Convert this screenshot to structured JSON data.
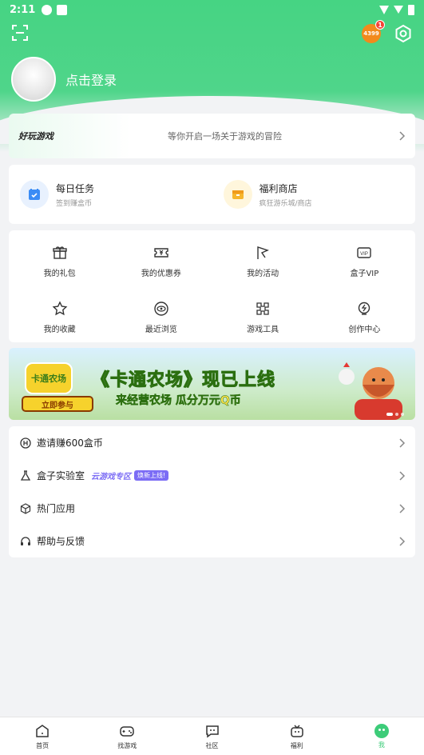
{
  "status_bar": {
    "time": "2:11"
  },
  "header": {
    "login_text": "点击登录",
    "box_logo_text": "4399",
    "notification_count": "1"
  },
  "adventure": {
    "logo_text": "好玩游戏",
    "text": "等你开启一场关于游戏的冒险"
  },
  "tasks": [
    {
      "title": "每日任务",
      "subtitle": "签到赚盒币"
    },
    {
      "title": "福利商店",
      "subtitle": "疯狂游乐城/商店"
    }
  ],
  "grid": [
    {
      "label": "我的礼包",
      "icon": "gift-icon"
    },
    {
      "label": "我的优惠券",
      "icon": "coupon-icon"
    },
    {
      "label": "我的活动",
      "icon": "flag-icon"
    },
    {
      "label": "盒子VIP",
      "icon": "vip-icon"
    },
    {
      "label": "我的收藏",
      "icon": "star-icon"
    },
    {
      "label": "最近浏览",
      "icon": "eye-icon"
    },
    {
      "label": "游戏工具",
      "icon": "tool-icon"
    },
    {
      "label": "创作中心",
      "icon": "bulb-icon"
    }
  ],
  "banner": {
    "logo_text": "卡通农场",
    "title": "《卡通农场》现已上线",
    "subtitle": "来经营农场 瓜分万元Q币",
    "button": "立即参与"
  },
  "list": [
    {
      "label": "邀请赚600盒币",
      "icon": "coin-icon"
    },
    {
      "label": "盒子实验室",
      "icon": "lab-icon",
      "tag": "云游戏专区",
      "badge": "焕新上线!"
    },
    {
      "label": "热门应用",
      "icon": "cube-icon"
    },
    {
      "label": "帮助与反馈",
      "icon": "headset-icon"
    }
  ],
  "tabbar": [
    {
      "label": "首页",
      "icon": "home-icon"
    },
    {
      "label": "找游戏",
      "icon": "gamepad-icon"
    },
    {
      "label": "社区",
      "icon": "chat-icon"
    },
    {
      "label": "福利",
      "icon": "gift-box-icon"
    },
    {
      "label": "我",
      "icon": "me-icon",
      "active": true
    }
  ],
  "colors": {
    "brand_green": "#3dcc79",
    "accent_purple": "#7b6cf5"
  }
}
